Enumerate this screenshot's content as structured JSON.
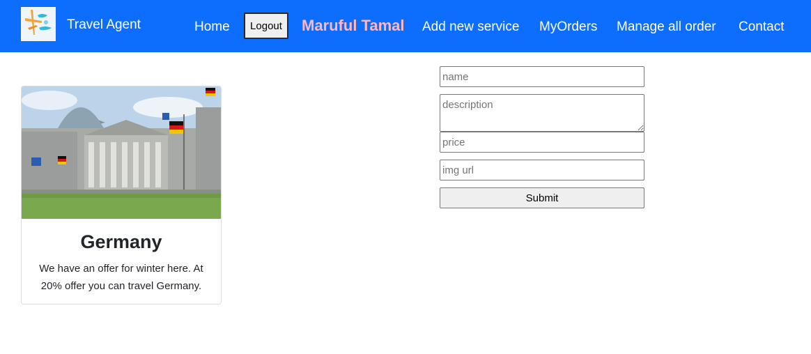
{
  "nav": {
    "brand": "Travel Agent",
    "home": "Home",
    "logout": "Logout",
    "user_name": "Maruful Tamal",
    "add_service": "Add new service",
    "my_orders": "MyOrders",
    "manage_orders": "Manage all order",
    "contact": "Contact"
  },
  "services": [
    {
      "title": "Germany",
      "description": "We have an offer for winter here. At 20% offer you can travel Germany."
    }
  ],
  "form": {
    "name_placeholder": "name",
    "description_placeholder": "description",
    "price_placeholder": "price",
    "img_placeholder": "img url",
    "submit_label": "Submit"
  },
  "colors": {
    "navbar": "#0d6efd",
    "user_name": "#ffb6c1"
  },
  "icons": {
    "logo": "travel-agent-logo"
  }
}
